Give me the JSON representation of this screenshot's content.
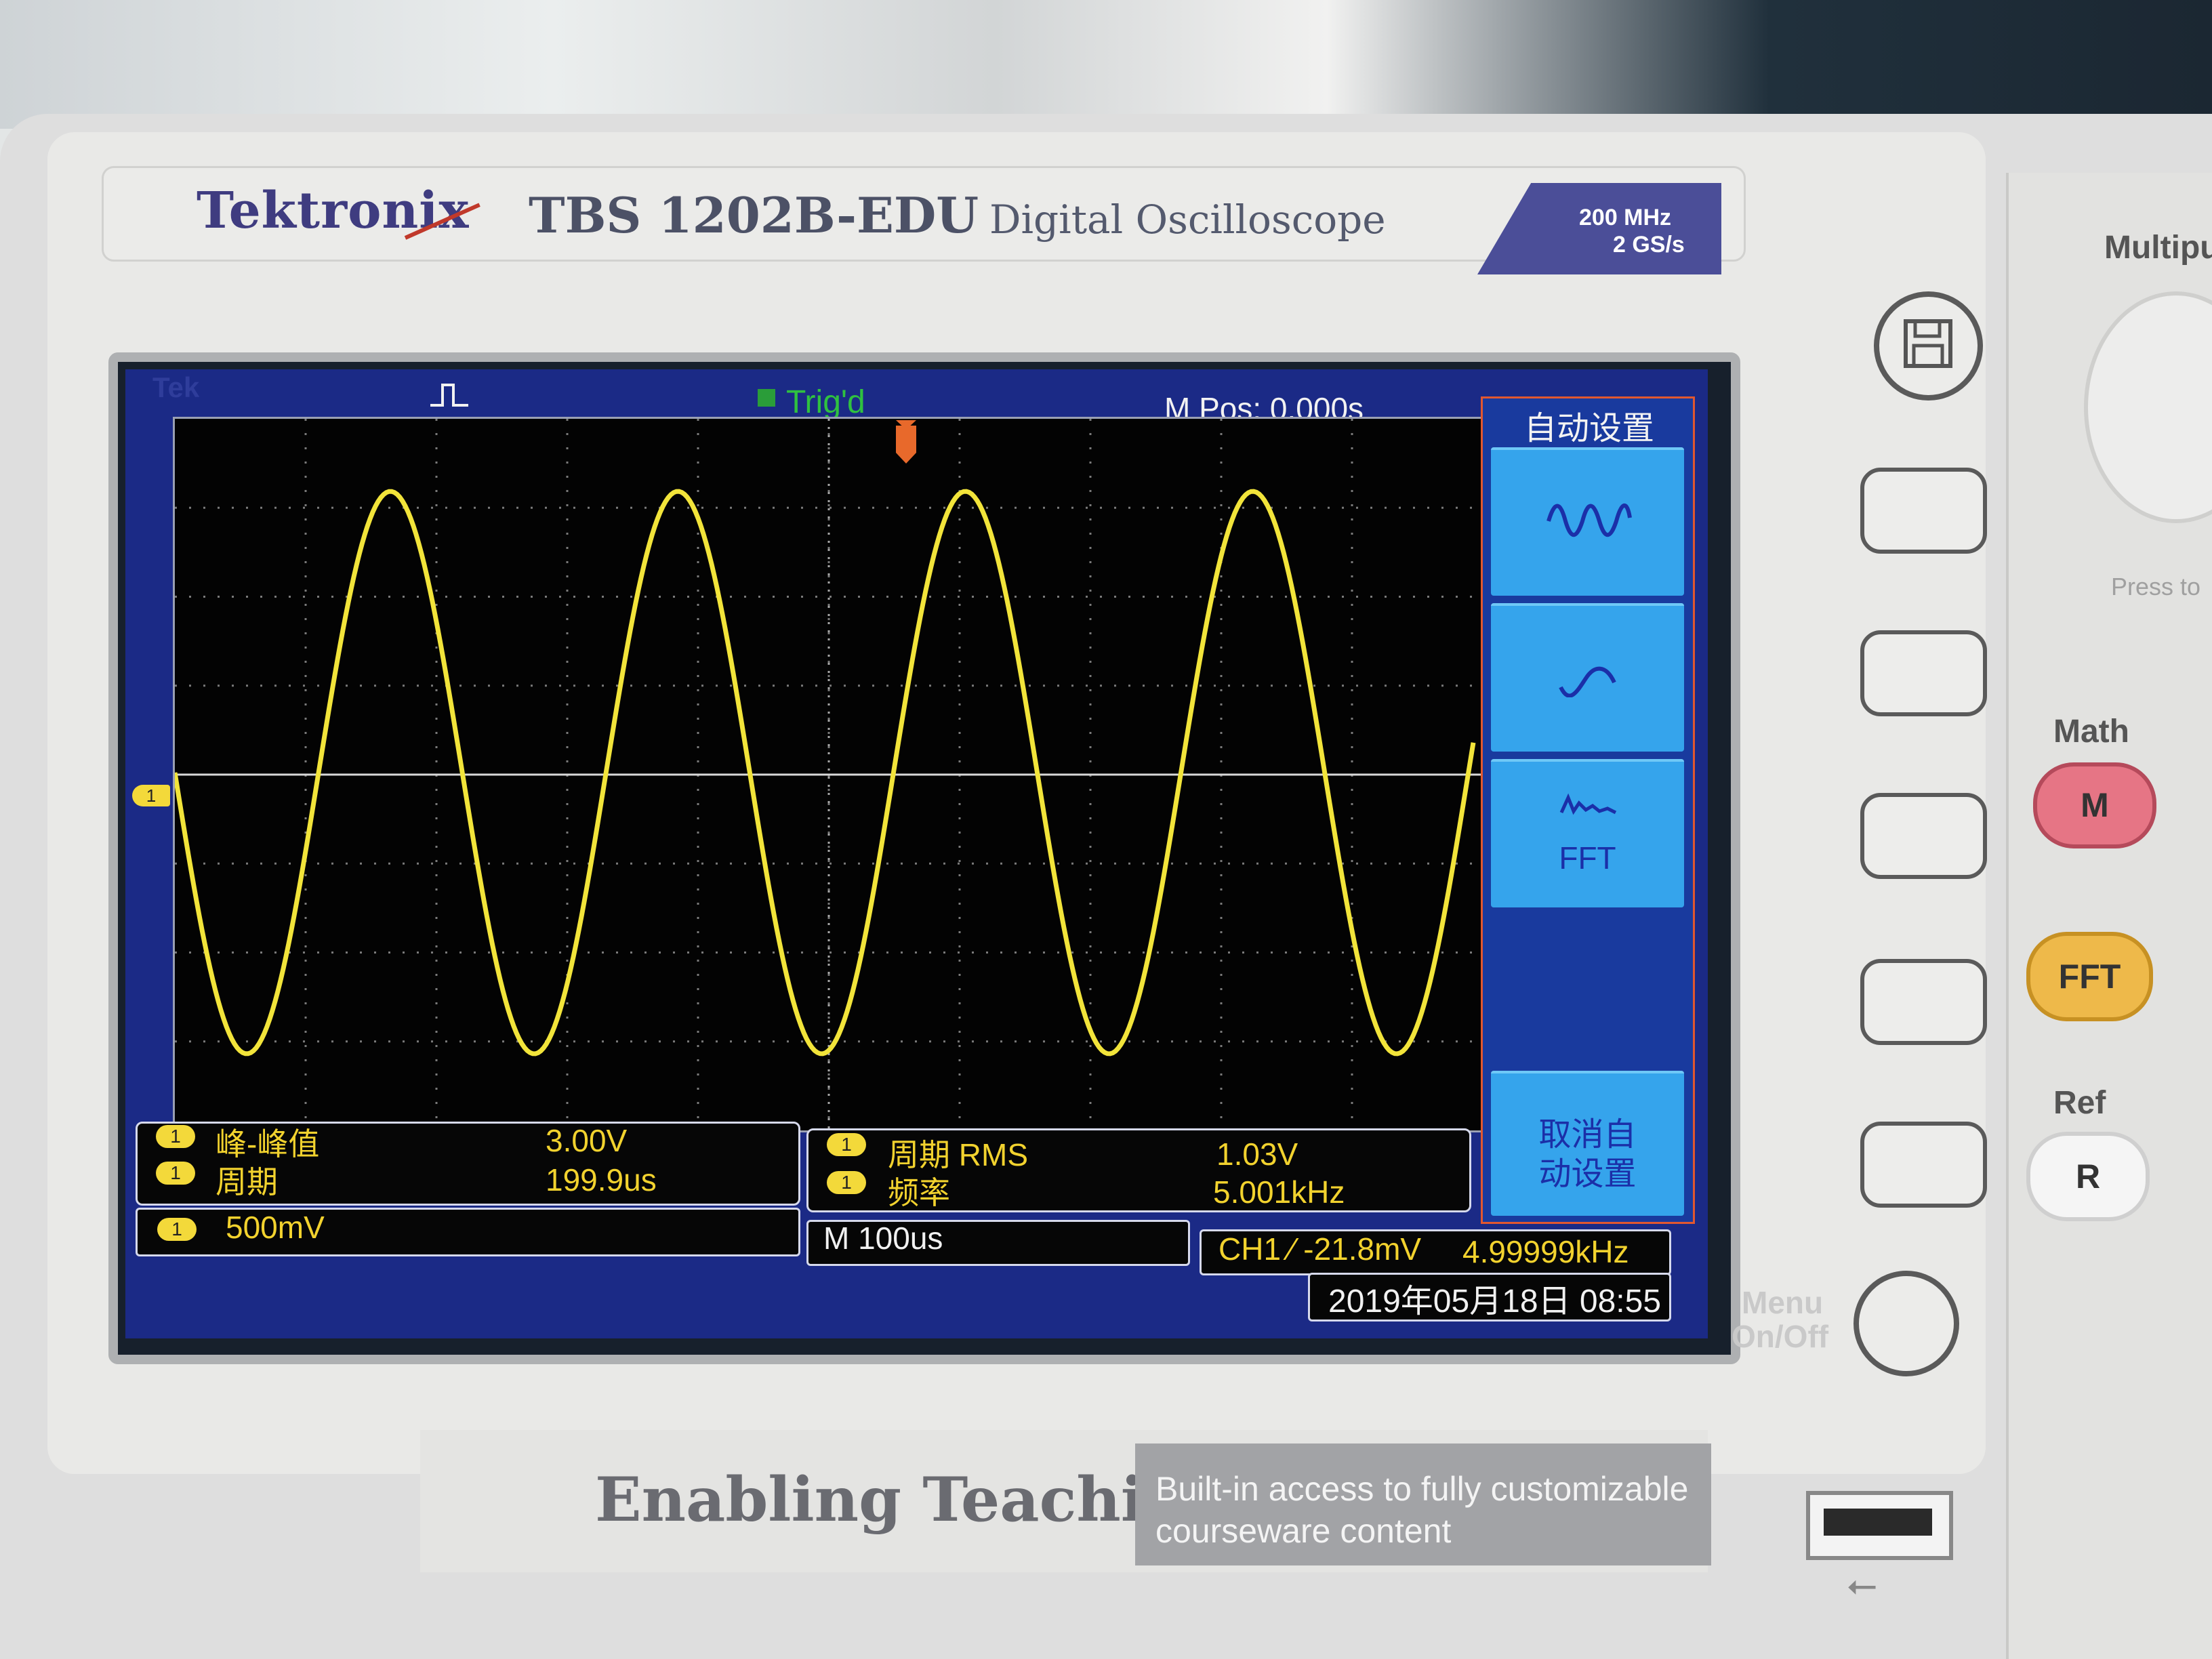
{
  "device": {
    "brand": "Tektronix",
    "model": "TBS 1202B-EDU",
    "subtitle": "Digital Oscilloscope",
    "spec_bandwidth": "200 MHz",
    "spec_samplerate": "2 GS/s"
  },
  "screen": {
    "tek_label": "Tek",
    "trigger_status": "Trig'd",
    "m_pos": "M Pos: 0.000s",
    "ch1_marker": "1",
    "trace_color": "#f2e43a",
    "waveform": {
      "type": "sine",
      "frequency": "5.001kHz",
      "peak_to_peak": "3.00V"
    }
  },
  "menu": {
    "title": "自动设置",
    "items": [
      {
        "icon": "multi-cycle-wave-icon",
        "label": ""
      },
      {
        "icon": "single-cycle-wave-icon",
        "label": ""
      },
      {
        "icon": "fft-wave-icon",
        "label": "FFT"
      },
      {
        "label": "取消自动设置",
        "line1": "取消自",
        "line2": "动设置"
      }
    ]
  },
  "measurements": {
    "left": [
      {
        "chip": "1",
        "label": "峰-峰值",
        "value": "3.00V"
      },
      {
        "chip": "1",
        "label": "周期",
        "value": "199.9us"
      }
    ],
    "right": [
      {
        "chip": "1",
        "label": "周期 RMS",
        "value": "1.03V"
      },
      {
        "chip": "1",
        "label": "频率",
        "value": "5.001kHz"
      }
    ]
  },
  "status": {
    "ch1_chip": "1",
    "ch1_scale": "500mV",
    "timebase": "M 100us",
    "trigger": "CH1 ⁄ -21.8mV",
    "trigger_freq": "4.99999kHz",
    "datetime": "2019年05月18日 08:55"
  },
  "panel": {
    "multipurpose": "Multipu",
    "press_to": "Press to",
    "math_label": "Math",
    "math_btn": "M",
    "fft_btn": "FFT",
    "ref_label": "Ref",
    "ref_btn": "R",
    "menu_onoff_1": "Menu",
    "menu_onoff_2": "On/Off"
  },
  "footer": {
    "enabling": "Enabling Teaching",
    "builtin_line1": "Built-in access to fully customizable",
    "builtin_line2": "courseware content"
  }
}
